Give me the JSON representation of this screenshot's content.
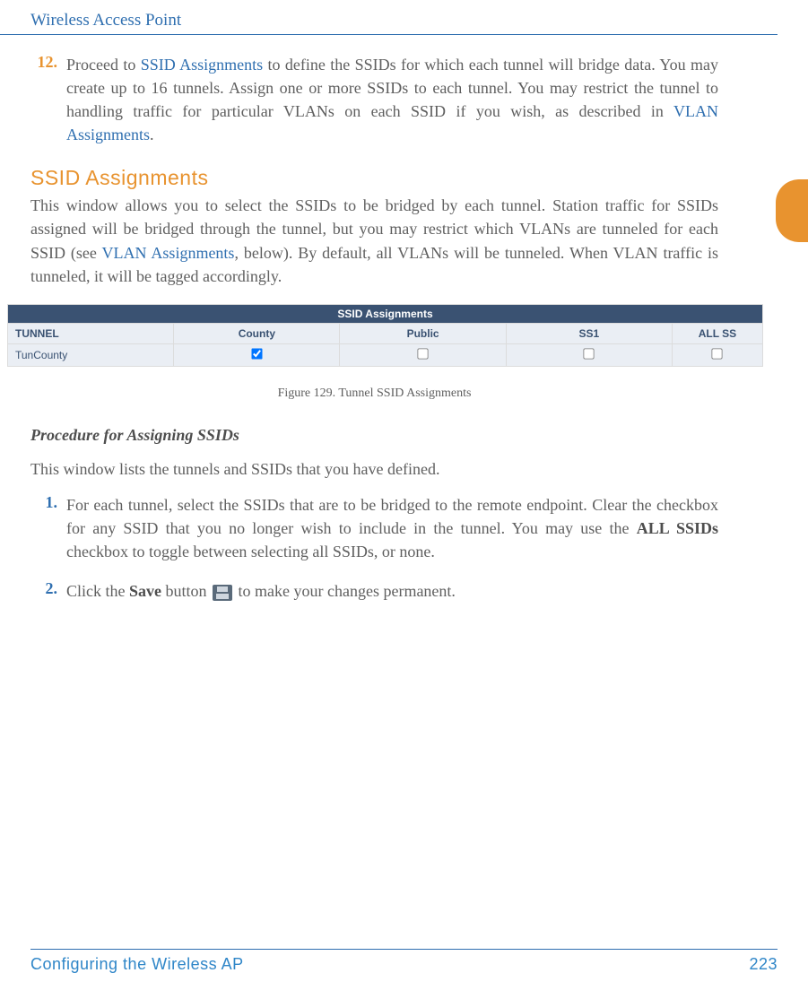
{
  "header": "Wireless Access Point",
  "step12": {
    "num": "12.",
    "text_pre": "Proceed to ",
    "link1": "SSID Assignments",
    "text_mid": " to define the SSIDs for which each tunnel will bridge data. You may create up to 16 tunnels. Assign one or more SSIDs to each tunnel. You may restrict the tunnel to handling traffic for particular VLANs on each SSID if you wish, as described in ",
    "link2": "VLAN Assignments",
    "text_end": "."
  },
  "section1": {
    "title": "SSID Assignments",
    "para_pre": "This window allows you to select the SSIDs to be bridged by each tunnel. Station traffic for SSIDs assigned will be bridged through the tunnel, but you may restrict which VLANs are tunneled for each SSID (see ",
    "link": "VLAN Assignments",
    "para_post": ", below). By default, all VLANs will be tunneled. When VLAN traffic is tunneled, it will be tagged accordingly."
  },
  "figure": {
    "titlebar": "SSID Assignments",
    "headers": [
      "TUNNEL",
      "County",
      "Public",
      "SS1",
      "ALL SS"
    ],
    "row": {
      "tunnel": "TunCounty",
      "county_checked": true,
      "public_checked": false,
      "ss1_checked": false,
      "allss_checked": false
    },
    "caption": "Figure 129. Tunnel SSID Assignments"
  },
  "procedure": {
    "title": "Procedure for Assigning SSIDs",
    "intro": "This window lists the tunnels and SSIDs that you have defined.",
    "step1": {
      "num": "1.",
      "text_pre": "For each tunnel, select the SSIDs that are to be bridged to the remote endpoint. Clear the checkbox for any SSID that you no longer wish to include in the tunnel. You may use the ",
      "bold": "ALL SSIDs",
      "text_post": " checkbox to toggle between selecting all SSIDs, or none."
    },
    "step2": {
      "num": "2.",
      "text_pre": "Click the ",
      "bold": "Save",
      "text_mid": " button ",
      "text_post": " to make your changes permanent."
    }
  },
  "footer": {
    "left": "Configuring the Wireless AP",
    "right": "223"
  }
}
